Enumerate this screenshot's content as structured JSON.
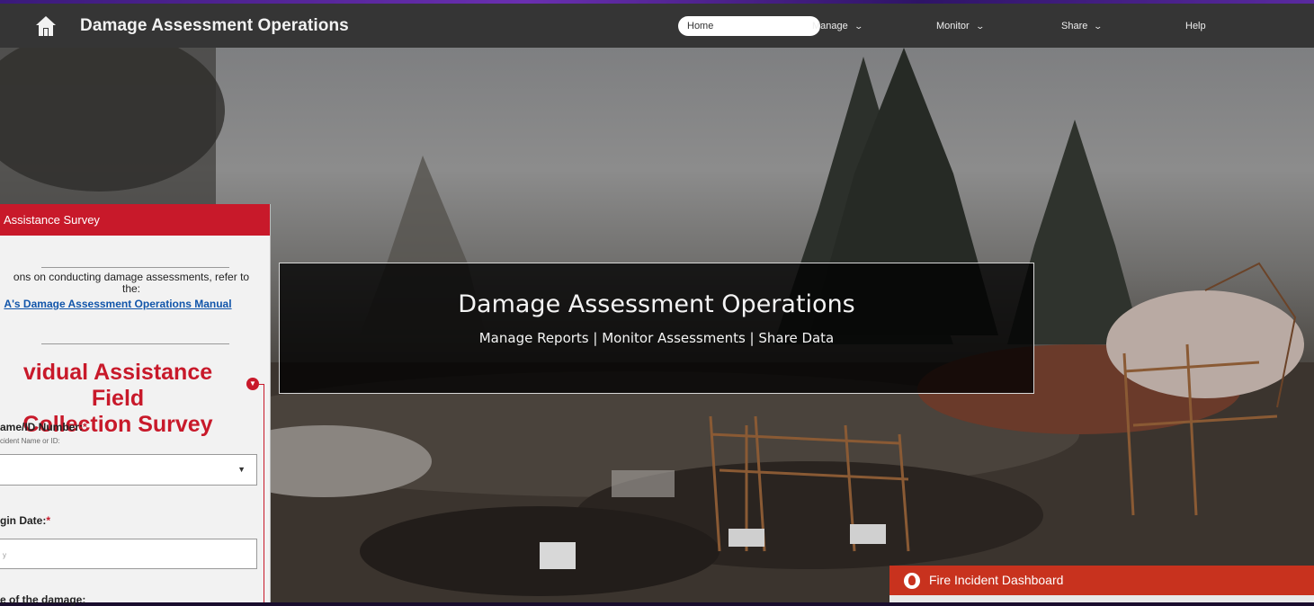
{
  "app": {
    "title": "Damage Assessment Operations"
  },
  "nav": {
    "home": "Home",
    "manage": "Manage",
    "monitor": "Monitor",
    "share": "Share",
    "help": "Help"
  },
  "banner": {
    "title": "Damage Assessment Operations",
    "subtitle": "Manage Reports | Monitor Assessments | Share Data"
  },
  "survey": {
    "header": "Assistance Survey",
    "intro_line1": "ons on conducting damage assessments, refer to",
    "intro_line2": "the:",
    "manual_link": "A's Damage Assessment Operations Manual",
    "form_title_line1": "vidual Assistance Field",
    "form_title_line2": "Collection Survey",
    "incident_label": "ame/ID Number:",
    "incident_required": "*",
    "incident_hint": "cident Name or ID:",
    "begin_date_label": "gin Date:",
    "begin_date_required": "*",
    "begin_date_placeholder": "y",
    "damage_label": "e of the damage:"
  },
  "dashboard": {
    "title": "Fire Incident Dashboard"
  },
  "colors": {
    "accent_red": "#c8192a",
    "navbar": "#353535",
    "dashboard_orange": "#c8321e"
  },
  "icons": [
    "house-logo-icon",
    "chevron-down-icon",
    "collapse-icon",
    "dropdown-arrow-icon",
    "fire-icon"
  ]
}
